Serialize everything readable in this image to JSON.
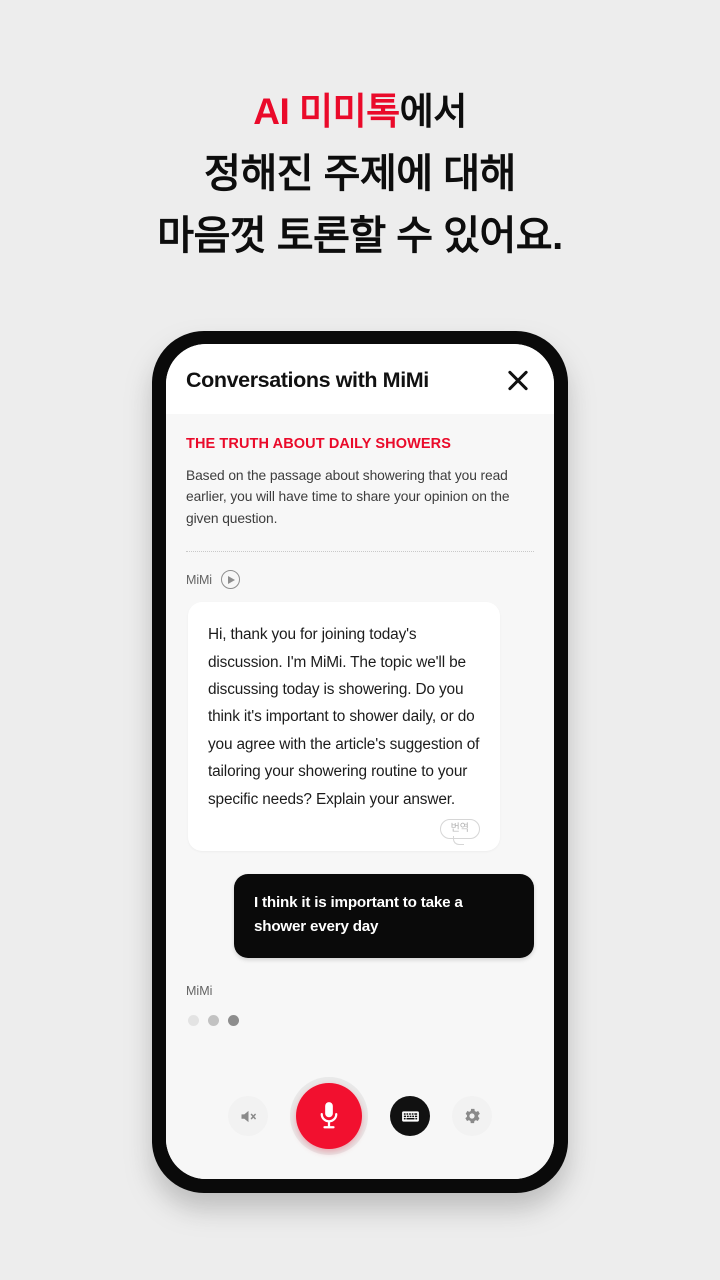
{
  "headline": {
    "line1_accent": "AI 미미톡",
    "line1_rest": "에서",
    "line2": "정해진 주제에 대해",
    "line3": "마음껏 토론할 수 있어요.",
    "accent_color": "#ea0a2a"
  },
  "app": {
    "title": "Conversations with MiMi",
    "close_icon": "close-icon"
  },
  "topic": {
    "title": "THE TRUTH ABOUT DAILY SHOWERS",
    "description": "Based on the passage about showering that you read earlier, you will have time to share your opinion on the given question."
  },
  "conversation": {
    "mimi_speaker_label": "MiMi",
    "play_icon": "play-circle-icon",
    "mimi_message": "Hi, thank you for joining today's discussion. I'm MiMi. The topic we'll be discussing today is showering. Do you think it's important to shower daily, or do you agree with the article's suggestion of tailoring your showering routine to your specific needs? Explain your answer.",
    "translate_label": "번역",
    "user_message": "I think it is important to take a shower every day",
    "typing_speaker_label": "MiMi",
    "typing_dots": [
      "#e3e3e3",
      "#c2c2c2",
      "#8d8d8d"
    ]
  },
  "controls": {
    "mute_icon": "speaker-mute-icon",
    "mic_icon": "microphone-icon",
    "keyboard_icon": "keyboard-icon",
    "settings_icon": "gear-icon",
    "mic_color": "#f2102f"
  }
}
